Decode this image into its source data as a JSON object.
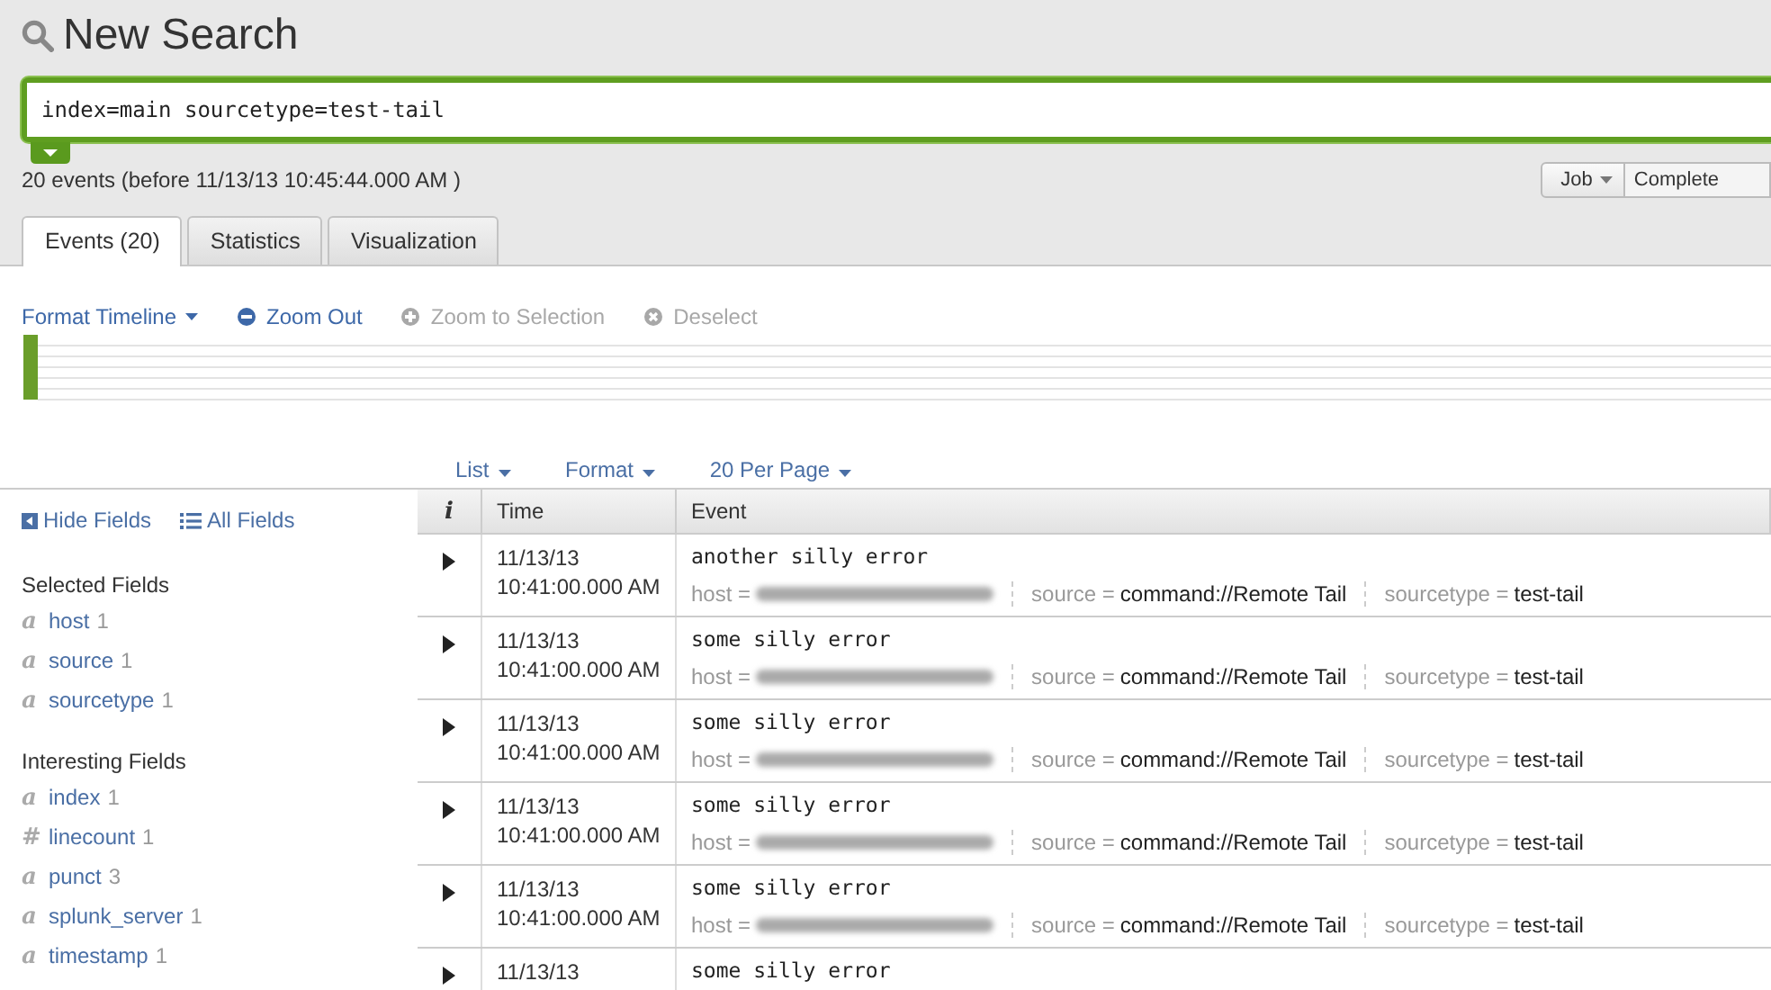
{
  "title": "New Search",
  "search": {
    "value": "index=main sourcetype=test-tail"
  },
  "summary": "20 events (before 11/13/13 10:45:44.000 AM )",
  "job": {
    "menu": "Job",
    "status": "Complete"
  },
  "tabs": [
    {
      "label": "Events (20)",
      "selected": true
    },
    {
      "label": "Statistics",
      "selected": false
    },
    {
      "label": "Visualization",
      "selected": false
    }
  ],
  "timeline_actions": [
    {
      "label": "Format Timeline",
      "kind": "menu",
      "disabled": false
    },
    {
      "label": "Zoom Out",
      "kind": "minus",
      "disabled": false
    },
    {
      "label": "Zoom to Selection",
      "kind": "plus",
      "disabled": true
    },
    {
      "label": "Deselect",
      "kind": "x",
      "disabled": true
    }
  ],
  "view_options": [
    "List",
    "Format",
    "20 Per Page"
  ],
  "sidebar": {
    "hide": "Hide Fields",
    "all": "All Fields",
    "groups": [
      {
        "title": "Selected Fields",
        "fields": [
          {
            "type": "a",
            "name": "host",
            "count": "1"
          },
          {
            "type": "a",
            "name": "source",
            "count": "1"
          },
          {
            "type": "a",
            "name": "sourcetype",
            "count": "1"
          }
        ]
      },
      {
        "title": "Interesting Fields",
        "fields": [
          {
            "type": "a",
            "name": "index",
            "count": "1"
          },
          {
            "type": "#",
            "name": "linecount",
            "count": "1"
          },
          {
            "type": "a",
            "name": "punct",
            "count": "3"
          },
          {
            "type": "a",
            "name": "splunk_server",
            "count": "1"
          },
          {
            "type": "a",
            "name": "timestamp",
            "count": "1"
          }
        ]
      }
    ]
  },
  "table": {
    "columns": [
      "i",
      "Time",
      "Event"
    ],
    "rows": [
      {
        "date": "11/13/13",
        "time": "10:41:00.000 AM",
        "event": "another silly error",
        "fields": [
          {
            "key": "host ="
          },
          {
            "key": "source =",
            "value": "command://Remote Tail"
          },
          {
            "key": "sourcetype =",
            "value": "test-tail"
          }
        ]
      },
      {
        "date": "11/13/13",
        "time": "10:41:00.000 AM",
        "event": "some silly error",
        "fields": [
          {
            "key": "host ="
          },
          {
            "key": "source =",
            "value": "command://Remote Tail"
          },
          {
            "key": "sourcetype =",
            "value": "test-tail"
          }
        ]
      },
      {
        "date": "11/13/13",
        "time": "10:41:00.000 AM",
        "event": "some silly error",
        "fields": [
          {
            "key": "host ="
          },
          {
            "key": "source =",
            "value": "command://Remote Tail"
          },
          {
            "key": "sourcetype =",
            "value": "test-tail"
          }
        ]
      },
      {
        "date": "11/13/13",
        "time": "10:41:00.000 AM",
        "event": "some silly error",
        "fields": [
          {
            "key": "host ="
          },
          {
            "key": "source =",
            "value": "command://Remote Tail"
          },
          {
            "key": "sourcetype =",
            "value": "test-tail"
          }
        ]
      },
      {
        "date": "11/13/13",
        "time": "10:41:00.000 AM",
        "event": "some silly error",
        "fields": [
          {
            "key": "host ="
          },
          {
            "key": "source =",
            "value": "command://Remote Tail"
          },
          {
            "key": "sourcetype =",
            "value": "test-tail"
          }
        ]
      },
      {
        "date": "11/13/13",
        "event": "some silly error"
      }
    ]
  }
}
